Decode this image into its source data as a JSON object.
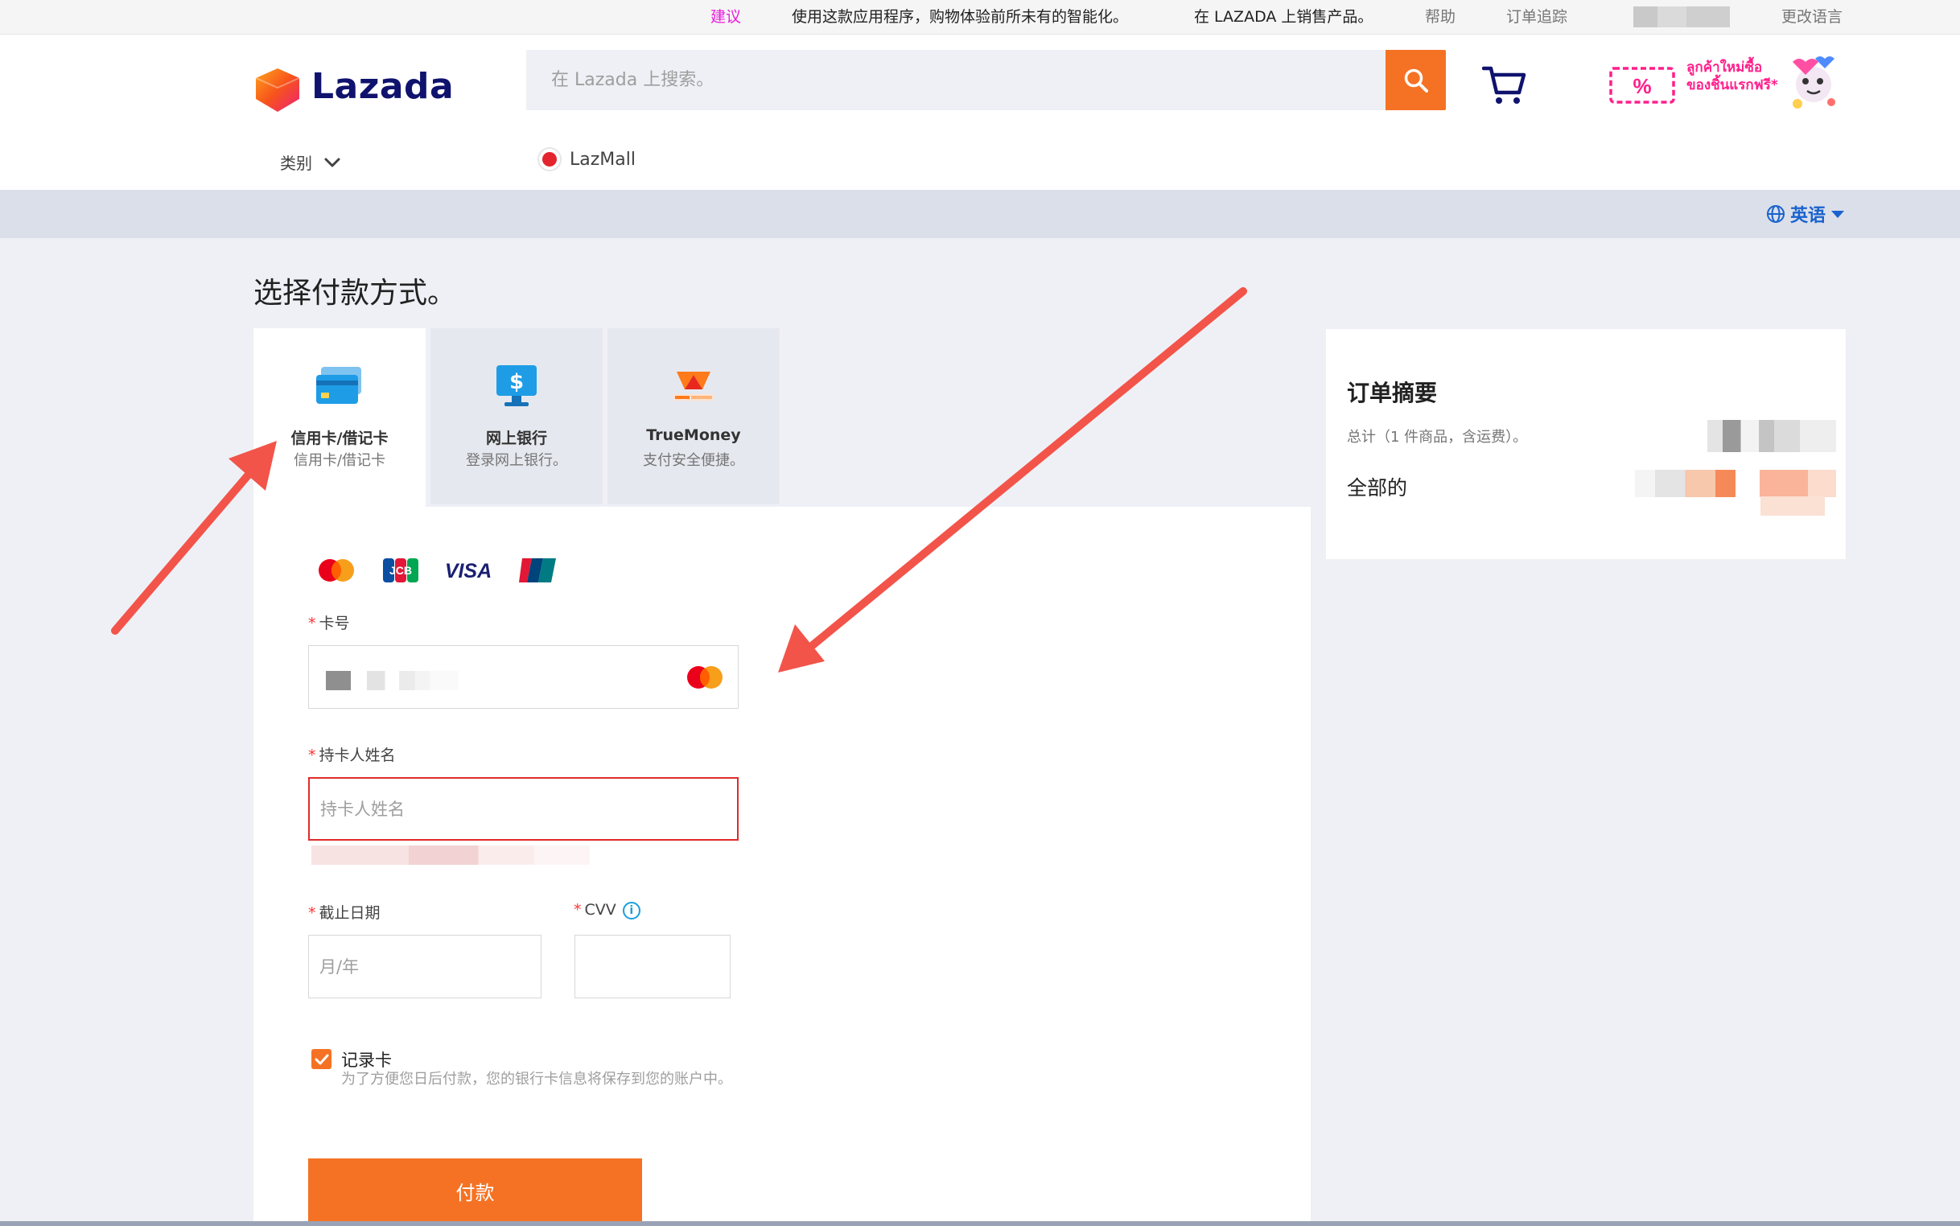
{
  "topbar": {
    "feedback": "建议",
    "app_promo": "使用这款应用程序，购物体验前所未有的智能化。",
    "sell": "在 LAZADA 上销售产品。",
    "help": "帮助",
    "order_tracking": "订单追踪",
    "change_language": "更改语言"
  },
  "header": {
    "logo_text": "Lazada",
    "search_placeholder": "在 Lazada 上搜索。",
    "promo_line1": "ลูกค้าใหม่ซื้อ",
    "promo_line2": "ของชิ้นแรกฟรี*",
    "promo_badge": "%",
    "category_label": "类别",
    "lazmall_label": "LazMall"
  },
  "lang_strip": {
    "language": "英语"
  },
  "payment": {
    "title": "选择付款方式。",
    "tabs": [
      {
        "title": "信用卡/借记卡",
        "subtitle": "信用卡/借记卡",
        "icon": "credit-card-icon",
        "active": true
      },
      {
        "title": "网上银行",
        "subtitle": "登录网上银行。",
        "icon": "online-banking-icon",
        "active": false
      },
      {
        "title": "TrueMoney",
        "subtitle": "支付安全便捷。",
        "icon": "truemoney-icon",
        "active": false
      }
    ],
    "card_brands": [
      "Mastercard",
      "JCB",
      "VISA",
      "UnionPay"
    ],
    "fields": {
      "card_number_label": "卡号",
      "card_holder_label": "持卡人姓名",
      "card_holder_placeholder": "持卡人姓名",
      "expiry_label": "截止日期",
      "expiry_placeholder": "月/年",
      "cvv_label": "CVV"
    },
    "remember": {
      "checked": true,
      "title": "记录卡",
      "description": "为了方便您日后付款，您的银行卡信息将保存到您的账户中。"
    },
    "pay_button": "付款"
  },
  "summary": {
    "title": "订单摘要",
    "subtotal_label": "总计（1 件商品，含运费）。",
    "total_label": "全部的"
  },
  "colors": {
    "accent": "#f57224",
    "brand_navy": "#0f136d",
    "link_blue": "#1a62ce",
    "error_red": "#e02b2b",
    "annotation_arrow": "#f2544a"
  }
}
